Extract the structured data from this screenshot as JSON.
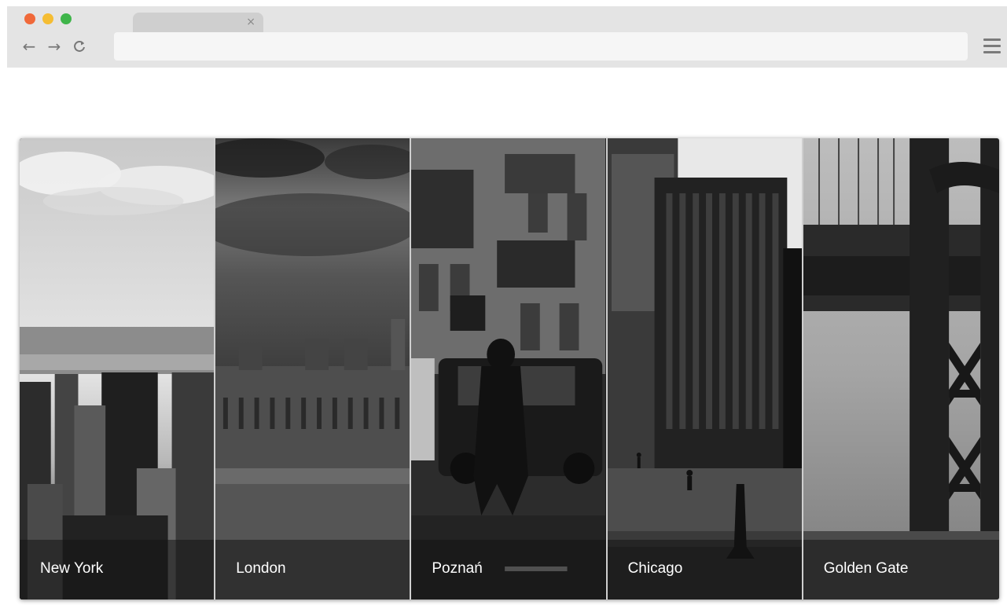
{
  "browser": {
    "window_controls": [
      {
        "name": "close",
        "color": "#f0693a"
      },
      {
        "name": "minimize",
        "color": "#f5bd33"
      },
      {
        "name": "maximize",
        "color": "#3fb54a"
      }
    ],
    "tab": {
      "title": "",
      "close_glyph": "×"
    },
    "nav": {
      "back_glyph": "←",
      "forward_glyph": "→",
      "reload_glyph": "C"
    },
    "address_bar": {
      "value": "",
      "placeholder": ""
    },
    "menu_icon": "hamburger-menu-icon"
  },
  "gallery": {
    "panels": [
      {
        "label": "New York",
        "photo": "new-york-skyline-photo"
      },
      {
        "label": "London",
        "photo": "london-parliament-photo"
      },
      {
        "label": "Poznań",
        "photo": "poznan-street-photo"
      },
      {
        "label": "Chicago",
        "photo": "chicago-tower-photo"
      },
      {
        "label": "Golden Gate",
        "photo": "golden-gate-bridge-photo"
      }
    ]
  }
}
